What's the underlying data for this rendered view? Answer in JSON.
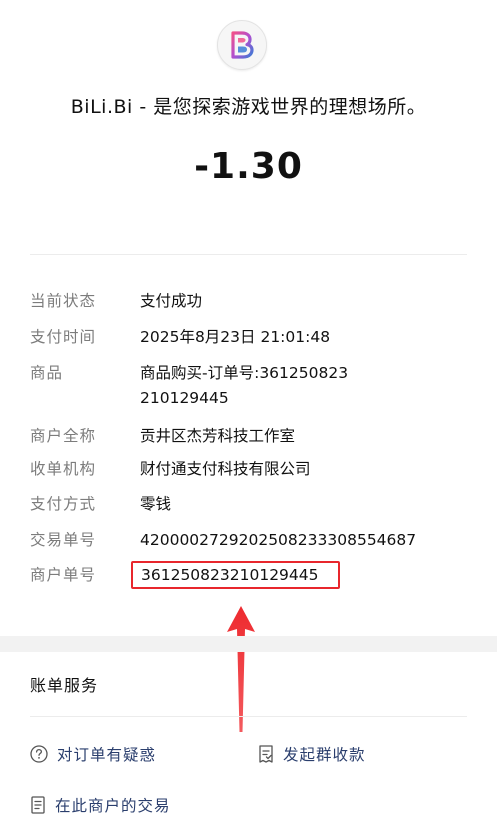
{
  "header": {
    "merchant_title": "BiLi.Bi - 是您探索游戏世界的理想场所。",
    "amount": "-1.30",
    "logo_icon": "bilibi-logo"
  },
  "details": [
    {
      "label": "当前状态",
      "value": "支付成功"
    },
    {
      "label": "支付时间",
      "value": "2025年8月23日 21:01:48"
    },
    {
      "label": "商品",
      "value": "商品购买-订单号:361250823210129445"
    },
    {
      "label": "商户全称",
      "value": "贡井区杰芳科技工作室"
    },
    {
      "label": "收单机构",
      "value": "财付通支付科技有限公司"
    },
    {
      "label": "支付方式",
      "value": "零钱"
    },
    {
      "label": "交易单号",
      "value": "4200002729202508233308554687"
    },
    {
      "label": "商户单号",
      "value": "361250823210129445"
    }
  ],
  "annotation": {
    "highlight_color": "#e8262c",
    "arrow_icon": "up-arrow"
  },
  "services": {
    "title": "账单服务",
    "items": [
      {
        "label": "对订单有疑惑",
        "icon": "question-circle-icon"
      },
      {
        "label": "发起群收款",
        "icon": "receipt-icon"
      },
      {
        "label": "在此商户的交易",
        "icon": "list-document-icon"
      }
    ]
  },
  "colors": {
    "label_gray": "#7c7c7c",
    "link_blue": "#2a3e6d",
    "annotation_red": "#e8262c"
  }
}
